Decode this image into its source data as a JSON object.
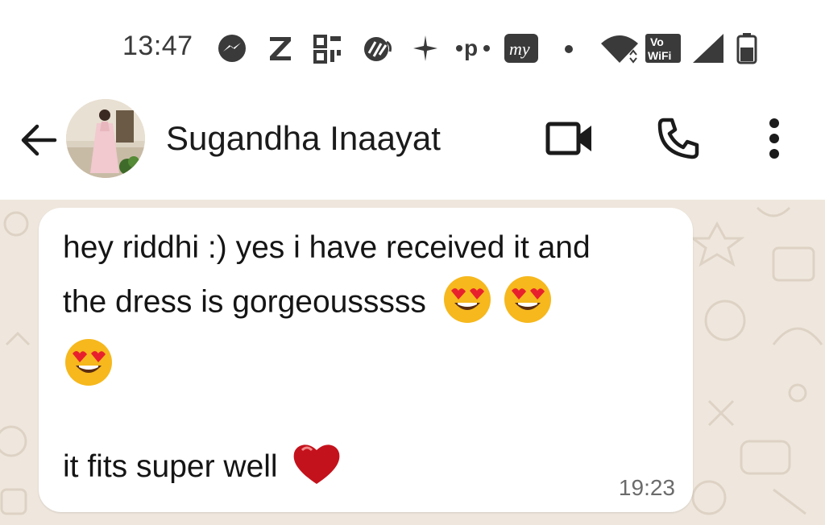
{
  "status_bar": {
    "time": "13:47",
    "icons": [
      "messenger-icon",
      "z-app-icon",
      "qr-scan-icon",
      "phonepe-like-icon",
      "sparkle-icon",
      "paytm-dot-icon",
      "myntra-icon",
      "dot-icon",
      "wifi-icon",
      "vowifi-icon",
      "signal-icon",
      "battery-icon"
    ],
    "vowifi_top": "Vo",
    "vowifi_bottom": "WiFi",
    "my_label": "my"
  },
  "header": {
    "contact_name": "Sugandha Inaayat",
    "icons": [
      "back-arrow-icon",
      "video-call-icon",
      "phone-call-icon",
      "more-vert-icon"
    ]
  },
  "message": {
    "line1": "hey riddhi :) yes i have received it and",
    "line2": "the dress is gorgeousssss",
    "line4": "it fits super well",
    "emojis": [
      "heart-eyes-emoji",
      "heart-eyes-emoji",
      "heart-eyes-emoji",
      "red-heart-emoji"
    ],
    "time": "19:23"
  },
  "colors": {
    "chat_background": "#efe7dd",
    "bubble": "#ffffff",
    "emoji_face": "#f6b81d",
    "heart": "#c4121c"
  }
}
